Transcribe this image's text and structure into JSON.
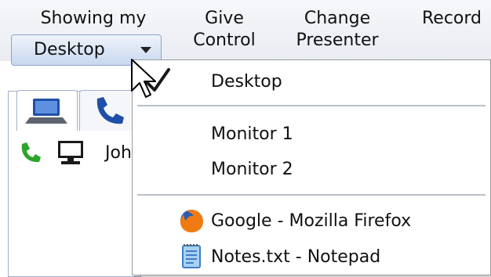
{
  "toolbar": {
    "showing_label": "Showing my",
    "desktop_button_label": "Desktop",
    "give_control_line1": "Give",
    "give_control_line2": "Control",
    "change_presenter_line1": "Change",
    "change_presenter_line2": "Presenter",
    "record_label": "Record"
  },
  "panel": {
    "tabs": [
      {
        "icon": "computer-icon"
      },
      {
        "icon": "phone-icon"
      }
    ],
    "participant_partial_name": "Joh"
  },
  "menu": {
    "items": [
      {
        "label": "Desktop",
        "selected": true
      },
      {
        "label": "Monitor 1"
      },
      {
        "label": "Monitor 2"
      },
      {
        "label": "Google - Mozilla Firefox",
        "icon": "firefox-icon"
      },
      {
        "label": "Notes.txt - Notepad",
        "icon": "notepad-icon"
      }
    ]
  },
  "colors": {
    "button_border": "#8ea3c8",
    "button_top": "#eef3fb",
    "button_bottom": "#c9d8ef",
    "menu_border": "#9a9a9a",
    "separator": "#b9c0cc",
    "panel_border": "#9fb0cb",
    "phone_green": "#2aa52a",
    "tab_icon_blue": "#1f4fa7"
  }
}
